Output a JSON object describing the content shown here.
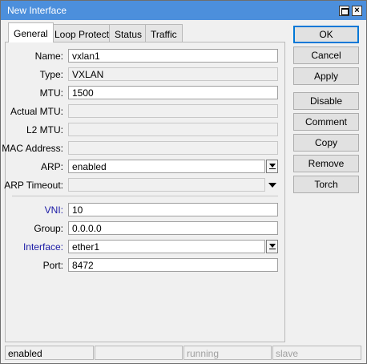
{
  "window": {
    "title": "New Interface"
  },
  "tabs": [
    {
      "label": "General",
      "active": true
    },
    {
      "label": "Loop Protect",
      "active": false
    },
    {
      "label": "Status",
      "active": false
    },
    {
      "label": "Traffic",
      "active": false
    }
  ],
  "form": {
    "name": {
      "label": "Name:",
      "value": "vxlan1"
    },
    "type": {
      "label": "Type:",
      "value": "VXLAN"
    },
    "mtu": {
      "label": "MTU:",
      "value": "1500"
    },
    "actual_mtu": {
      "label": "Actual MTU:",
      "value": ""
    },
    "l2_mtu": {
      "label": "L2 MTU:",
      "value": ""
    },
    "mac_address": {
      "label": "MAC Address:",
      "value": ""
    },
    "arp": {
      "label": "ARP:",
      "value": "enabled"
    },
    "arp_timeout": {
      "label": "ARP Timeout:",
      "value": ""
    },
    "vni": {
      "label": "VNI:",
      "value": "10"
    },
    "group": {
      "label": "Group:",
      "value": "0.0.0.0"
    },
    "interface": {
      "label": "Interface:",
      "value": "ether1"
    },
    "port": {
      "label": "Port:",
      "value": "8472"
    }
  },
  "buttons": {
    "ok": "OK",
    "cancel": "Cancel",
    "apply": "Apply",
    "disable": "Disable",
    "comment": "Comment",
    "copy": "Copy",
    "remove": "Remove",
    "torch": "Torch"
  },
  "status_bar": {
    "state": "enabled",
    "empty": "",
    "running": "running",
    "slave": "slave"
  },
  "colors": {
    "titlebar": "#4c8fdc",
    "link_label": "#1a1aa6",
    "default_button_border": "#0078d7"
  }
}
